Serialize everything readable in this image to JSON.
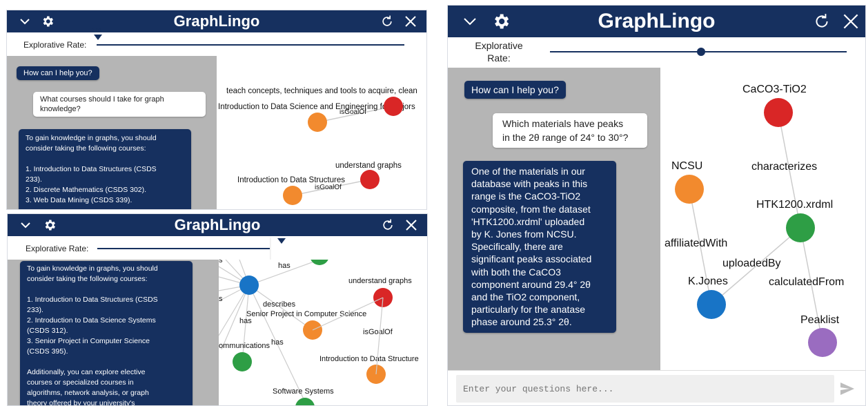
{
  "app": {
    "title": "GraphLingo",
    "colors": {
      "header": "#16305f",
      "chat_bg": "#b5b5b5",
      "node_red": "#d92626",
      "node_orange": "#f28a2e",
      "node_green": "#2e9e45",
      "node_blue": "#1874c6",
      "node_purple": "#9a6cc0"
    }
  },
  "panel_a": {
    "rate_label": "Explorative Rate:",
    "rate_value": "0.01",
    "rate_fraction": 0.01,
    "messages": [
      {
        "role": "bot",
        "text": "How can I help you?"
      },
      {
        "role": "user",
        "text": "What courses should I take for graph\nknowledge?"
      },
      {
        "role": "bot",
        "text": "To gain knowledge in graphs, you should\nconsider taking the following courses:\n\n1. Introduction to Data Structures (CSDS\n233).\n2. Discrete Mathematics (CSDS 302).\n3. Web Data Mining (CSDS 339)."
      }
    ],
    "graph_labels": {
      "teach": "teach concepts, techniques and tools to acquire, clean",
      "intro_ds_eng": "Introduction to Data Science and Engineering for Majors",
      "isgoalof1": "isGoalOf",
      "understand": "understand graphs",
      "intro_ds": "Introduction to Data Structures",
      "isgoalof2": "isGoalOf"
    }
  },
  "panel_b": {
    "rate_label": "Explorative Rate:",
    "rate_value": "0.60",
    "rate_fraction": 0.6,
    "messages": [
      {
        "role": "bot",
        "text": "To gain knowledge in graphs, you should\nconsider taking the following courses:\n\n1. Introduction to Data Structures (CSDS\n233).\n2. Introduction to Data Science Systems\n(CSDS 312).\n3. Senior Project in Computer Science\n(CSDS 395).\n\nAdditionally, you can explore elective\ncourses or specialized courses in\nalgorithms, network analysis, or graph\ntheory offered by your university's"
      }
    ],
    "graph_labels": {
      "s": "s",
      "has1": "has",
      "s2": "s",
      "describes": "describes",
      "has2": "has",
      "senior": "Senior Project in Computer Science",
      "understand": "understand graphs",
      "isgoalof": "isGoalOf",
      "comms": "ommunications",
      "has3": "has",
      "intro_ds": "Introduction to Data Structure",
      "software": "Software Systems"
    }
  },
  "panel_c": {
    "rate_label": "Explorative\nRate:",
    "rate_fraction": 0.6,
    "messages": [
      {
        "role": "bot",
        "text": "How can I help you?"
      },
      {
        "role": "user",
        "text": "Which materials have peaks\nin the 2θ range of 24° to 30°?"
      },
      {
        "role": "bot",
        "text": "One of the materials in our\ndatabase with peaks in this\nrange is the CaCO3-TiO2\ncomposite, from the dataset\n'HTK1200.xrdml' uploaded\nby K. Jones from NCSU.\nSpecifically, there are\nsignificant peaks associated\nwith both the CaCO3\ncomponent around 29.4° 2θ\nand the TiO2 component,\nparticularly for the anatase\nphase around 25.3° 2θ."
      }
    ],
    "graph_labels": {
      "cacotio": "CaCO3-TiO2",
      "characterizes": "characterizes",
      "ncsu": "NCSU",
      "htk": "HTK1200.xrdml",
      "affiliated": "affiliatedWith",
      "uploaded": "uploadedBy",
      "kjones": "K.Jones",
      "calculated": "calculatedFrom",
      "peaklist": "Peaklist"
    },
    "input_placeholder": "Enter your questions here..."
  }
}
